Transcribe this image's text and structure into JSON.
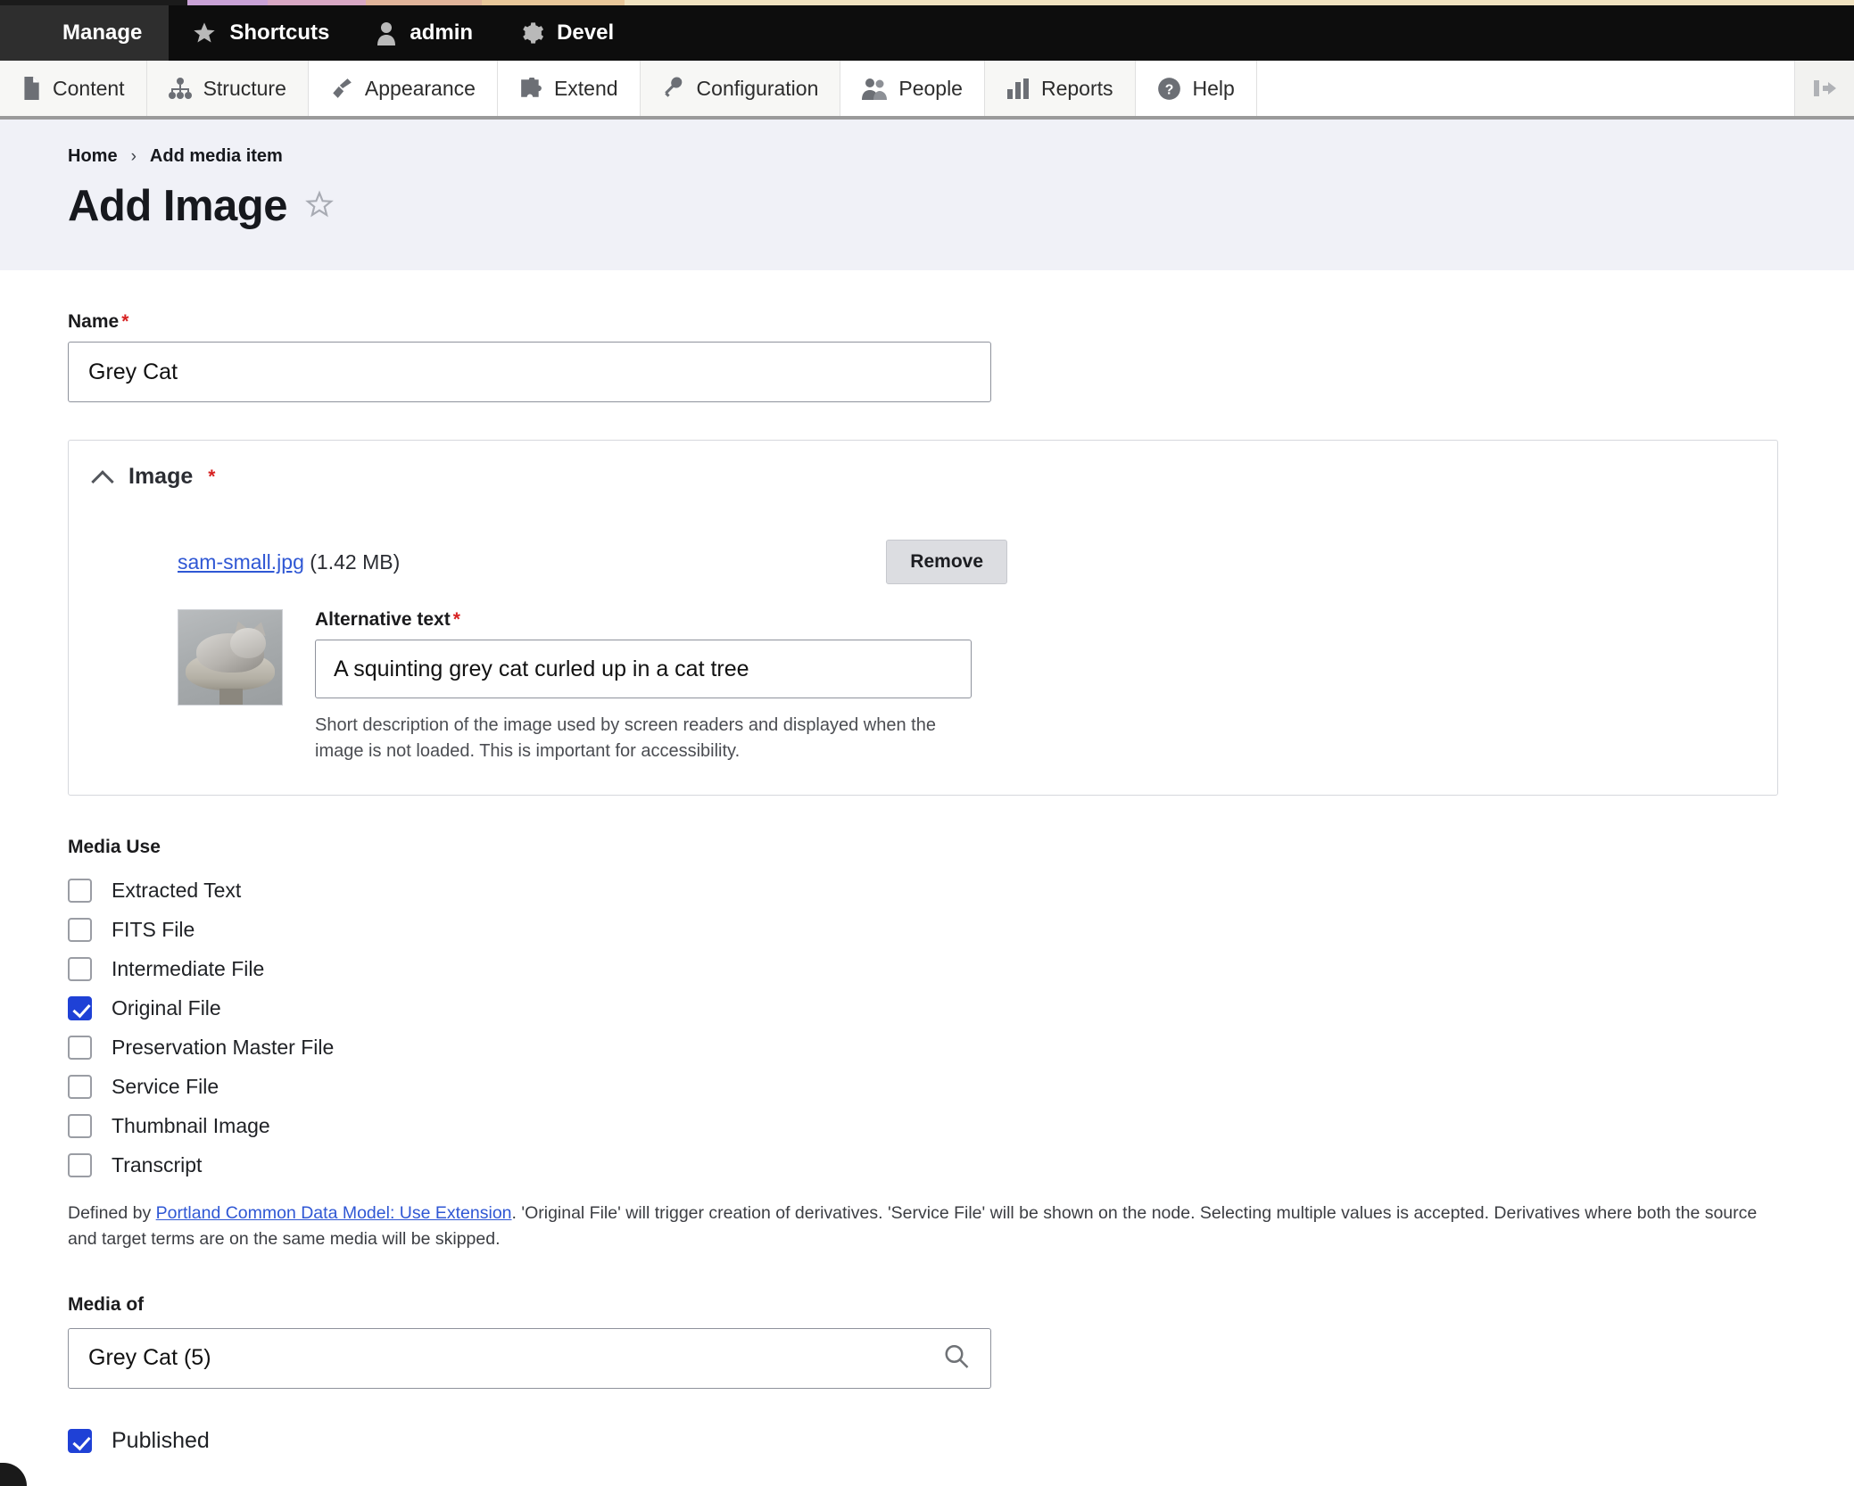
{
  "accent_colors": [
    "#1b1b1b",
    "#c9a2d6",
    "#d8a8c4",
    "#e0b49a",
    "#e8c79a",
    "#f0e2c0"
  ],
  "toolbar": {
    "tabs": [
      {
        "label": "Manage",
        "icon": "hamburger-icon",
        "active": true
      },
      {
        "label": "Shortcuts",
        "icon": "star-icon",
        "active": false
      },
      {
        "label": "admin",
        "icon": "user-icon",
        "active": false
      },
      {
        "label": "Devel",
        "icon": "gear-icon",
        "active": false
      }
    ]
  },
  "menu": {
    "items": [
      {
        "label": "Content",
        "icon": "file-icon"
      },
      {
        "label": "Structure",
        "icon": "sitemap-icon"
      },
      {
        "label": "Appearance",
        "icon": "paintbrush-icon"
      },
      {
        "label": "Extend",
        "icon": "puzzle-icon"
      },
      {
        "label": "Configuration",
        "icon": "wrench-icon"
      },
      {
        "label": "People",
        "icon": "people-icon"
      },
      {
        "label": "Reports",
        "icon": "bar-chart-icon"
      },
      {
        "label": "Help",
        "icon": "question-circle-icon"
      }
    ],
    "collapse_icon": "collapse-toolbar-icon"
  },
  "header": {
    "breadcrumb": [
      "Home",
      "Add media item"
    ],
    "separator": "›",
    "title": "Add Image",
    "star_icon": "star-outline-icon"
  },
  "form": {
    "name": {
      "label": "Name",
      "required_marker": "*",
      "value": "Grey Cat",
      "placeholder": ""
    },
    "image_fieldset": {
      "title": "Image",
      "required_marker": "*",
      "collapse_icon": "chevron-up-icon",
      "file_link": "sam-small.jpg",
      "file_size": "(1.42 MB)",
      "remove_label": "Remove",
      "thumbnail_alt": "Grey cat curled in a cat tree",
      "alt_text": {
        "label": "Alternative text",
        "required_marker": "*",
        "value": "A squinting grey cat curled up in a cat tree",
        "description": "Short description of the image used by screen readers and displayed when the image is not loaded. This is important for accessibility."
      }
    },
    "media_use": {
      "label": "Media Use",
      "options": [
        {
          "label": "Extracted Text",
          "checked": false
        },
        {
          "label": "FITS File",
          "checked": false
        },
        {
          "label": "Intermediate File",
          "checked": false
        },
        {
          "label": "Original File",
          "checked": true
        },
        {
          "label": "Preservation Master File",
          "checked": false
        },
        {
          "label": "Service File",
          "checked": false
        },
        {
          "label": "Thumbnail Image",
          "checked": false
        },
        {
          "label": "Transcript",
          "checked": false
        }
      ],
      "description_prefix": "Defined by ",
      "description_link": "Portland Common Data Model: Use Extension",
      "description_suffix": ". 'Original File' will trigger creation of derivatives. 'Service File' will be shown on the node. Selecting multiple values is accepted. Derivatives where both the source and target terms are on the same media will be skipped."
    },
    "media_of": {
      "label": "Media of",
      "value": "Grey Cat (5)",
      "placeholder": "",
      "search_icon": "search-icon"
    },
    "published": {
      "label": "Published",
      "checked": true
    }
  },
  "colors": {
    "accent_blue": "#1f41d6",
    "link_blue": "#2f57d4",
    "required_red": "#d72222",
    "toolbar_black": "#0d0d0d",
    "header_bg": "#f0f1f7"
  }
}
